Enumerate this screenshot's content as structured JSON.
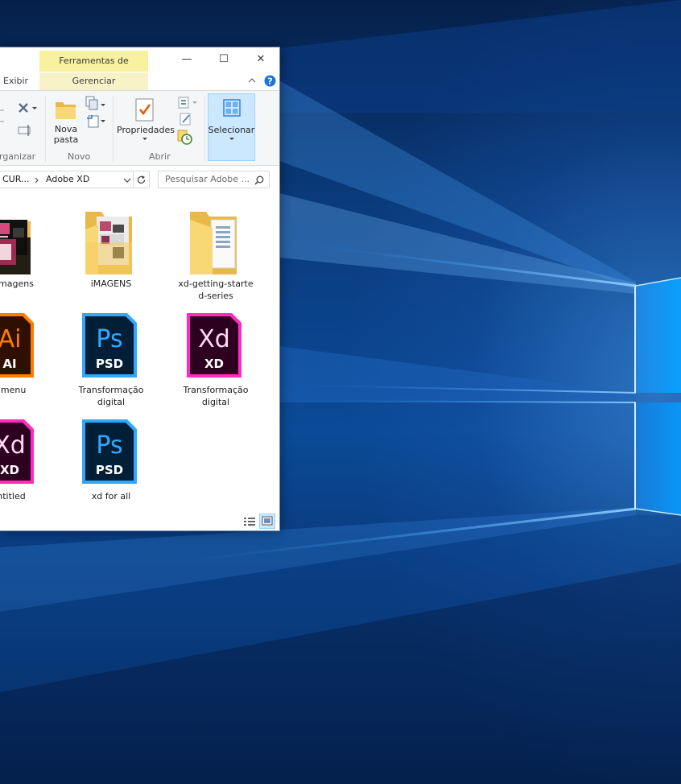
{
  "window": {
    "context_tab": "Ferramentas de Imagem",
    "minimize_glyph": "—",
    "maximize_glyph": "☐",
    "close_glyph": "✕"
  },
  "ribbon_tabs": {
    "view": "Exibir",
    "manage": "Gerenciar"
  },
  "ribbon": {
    "groups": {
      "organize": "rganizar",
      "new": "Novo",
      "open": "Abrir"
    },
    "new_folder_line1": "Nova",
    "new_folder_line2": "pasta",
    "properties": "Propriedades",
    "select": "Selecionar"
  },
  "address": {
    "crumb_prev": "CUR...",
    "crumb_current": "Adobe XD",
    "search_placeholder": "Pesquisar Adobe ..."
  },
  "items": [
    {
      "label": "magens",
      "type": "folder-dark"
    },
    {
      "label": "iMAGENS",
      "type": "folder"
    },
    {
      "label_line1": "xd-getting-starte",
      "label_line2": "d-series",
      "type": "folder"
    },
    {
      "label": "lo menu",
      "type": "ai",
      "badge_top": "Ai",
      "badge_bottom": "AI"
    },
    {
      "label_line1": "Transformação",
      "label_line2": "digital",
      "type": "psd",
      "badge_top": "Ps",
      "badge_bottom": "PSD"
    },
    {
      "label_line1": "Transformação",
      "label_line2": "digital",
      "type": "xd",
      "badge_top": "Xd",
      "badge_bottom": "XD"
    },
    {
      "label": "ntitled",
      "type": "xd",
      "badge_top": "Xd",
      "badge_bottom": "XD"
    },
    {
      "label": "xd for all",
      "type": "psd",
      "badge_top": "Ps",
      "badge_bottom": "PSD"
    }
  ],
  "colors": {
    "ai_orange": "#ff7c00",
    "ai_bg": "#2e0f00",
    "ps_blue": "#31a8ff",
    "ps_bg": "#001e36",
    "xd_pink": "#ff2bc2",
    "xd_bg": "#2e001f",
    "folder_yellow": "#f8d775",
    "context_tab_bg": "#f8f1a0",
    "select_highlight": "#cce8ff"
  }
}
